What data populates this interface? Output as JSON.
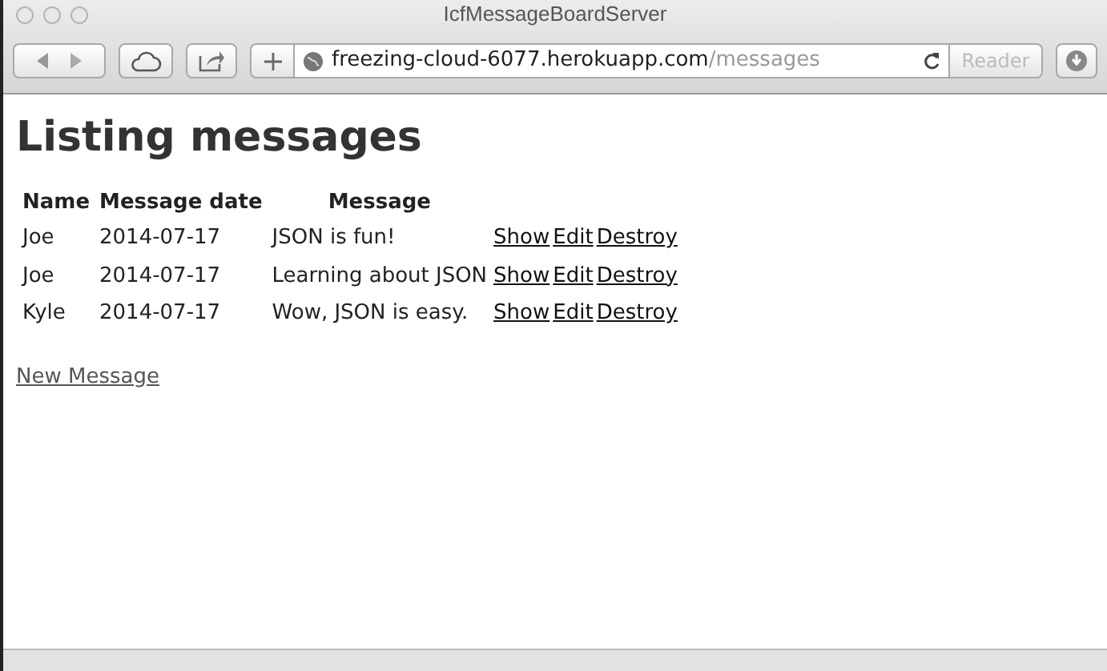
{
  "window": {
    "title": "IcfMessageBoardServer"
  },
  "toolbar": {
    "url_host": "freezing-cloud-6077.herokuapp.com",
    "url_path": "/messages",
    "reader_label": "Reader"
  },
  "page": {
    "heading": "Listing messages",
    "table": {
      "columns": [
        "Name",
        "Message date",
        "Message"
      ],
      "rows": [
        {
          "name": "Joe",
          "date": "2014-07-17",
          "message": "JSON is fun!",
          "actions": [
            "Show",
            "Edit",
            "Destroy"
          ]
        },
        {
          "name": "Joe",
          "date": "2014-07-17",
          "message": "Learning about JSON",
          "actions": [
            "Show",
            "Edit",
            "Destroy"
          ]
        },
        {
          "name": "Kyle",
          "date": "2014-07-17",
          "message": "Wow, JSON is easy.",
          "actions": [
            "Show",
            "Edit",
            "Destroy"
          ]
        }
      ]
    },
    "new_link": "New Message"
  }
}
